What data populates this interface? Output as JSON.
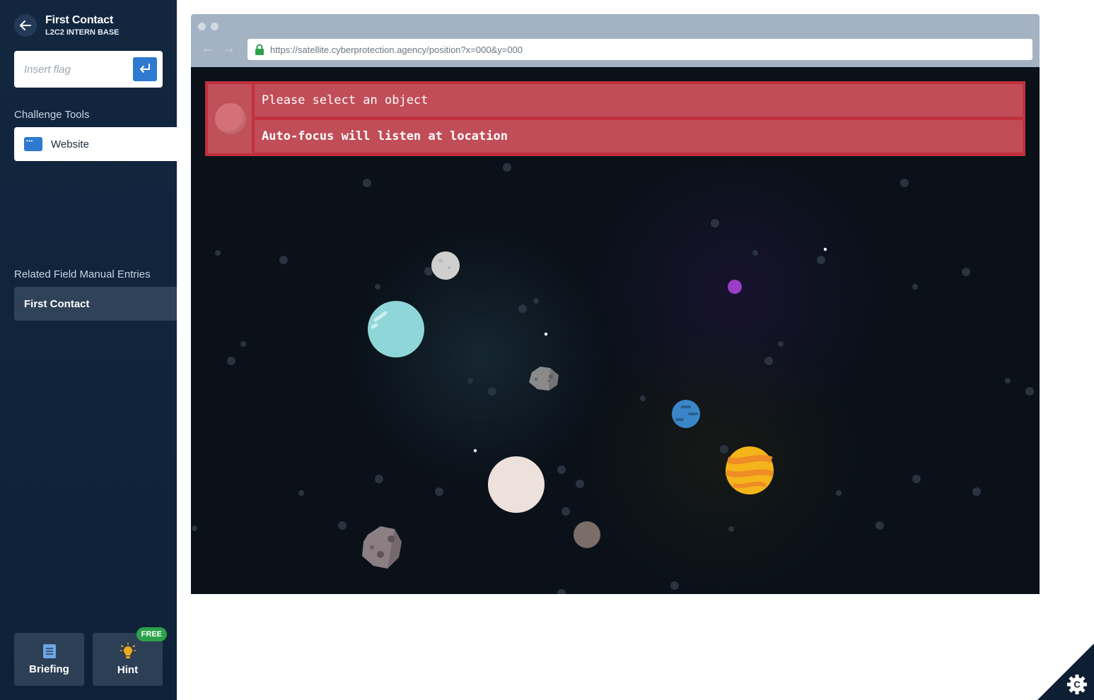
{
  "header": {
    "title": "First Contact",
    "subtitle": "L2C2 INTERN BASE"
  },
  "flag": {
    "placeholder": "Insert flag"
  },
  "sections": {
    "tools": "Challenge Tools",
    "manual": "Related Field Manual Entries"
  },
  "tools": [
    {
      "label": "Website",
      "icon": "browser-window-icon"
    }
  ],
  "manual_entries": [
    {
      "label": "First Contact"
    }
  ],
  "bottom": {
    "briefing": "Briefing",
    "hint": "Hint",
    "hint_badge": "FREE"
  },
  "browser": {
    "url": "https://satellite.cyberprotection.agency/position?x=000&y=000"
  },
  "panel": {
    "line1": "Please select an object",
    "line2": "Auto-focus will listen at location"
  },
  "colors": {
    "sidebar_bg": "#12263f",
    "accent_blue": "#2d7ad0",
    "panel_red": "#c0303f",
    "badge_green": "#2aa14a",
    "space_bg": "#0a1119"
  }
}
